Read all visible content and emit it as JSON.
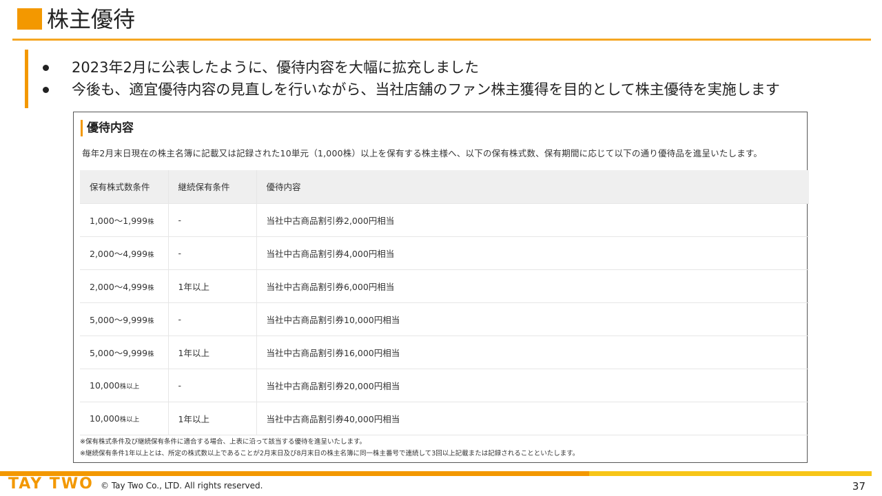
{
  "header": {
    "title": "株主優待"
  },
  "bullets": [
    "2023年2月に公表したように、優待内容を大幅に拡充しました",
    "今後も、適宜優待内容の見直しを行いながら、当社店舗のファン株主獲得を目的として株主優待を実施します"
  ],
  "panel": {
    "heading": "優待内容",
    "intro": "毎年2月末日現在の株主名簿に記載又は記録された10単元（1,000株）以上を保有する株主様へ、以下の保有株式数、保有期間に応じて以下の通り優待品を進呈いたします。",
    "columns": [
      "保有株式数条件",
      "継続保有条件",
      "優待内容"
    ],
    "rows": [
      {
        "shares": "1,000〜1,999",
        "unit": "株",
        "holding": "-",
        "benefit": "当社中古商品割引券2,000円相当"
      },
      {
        "shares": "2,000〜4,999",
        "unit": "株",
        "holding": "-",
        "benefit": "当社中古商品割引券4,000円相当"
      },
      {
        "shares": "2,000〜4,999",
        "unit": "株",
        "holding": "1年以上",
        "benefit": "当社中古商品割引券6,000円相当"
      },
      {
        "shares": "5,000〜9,999",
        "unit": "株",
        "holding": "-",
        "benefit": "当社中古商品割引券10,000円相当"
      },
      {
        "shares": "5,000〜9,999",
        "unit": "株",
        "holding": "1年以上",
        "benefit": "当社中古商品割引券16,000円相当"
      },
      {
        "shares": "10,000",
        "unit": "株以上",
        "holding": "-",
        "benefit": "当社中古商品割引券20,000円相当"
      },
      {
        "shares": "10,000",
        "unit": "株以上",
        "holding": "1年以上",
        "benefit": "当社中古商品割引券40,000円相当"
      }
    ],
    "notes": [
      "※保有株式条件及び継続保有条件に適合する場合、上表に沿って該当する優待を進呈いたします。",
      "※継続保有条件1年以上とは、所定の株式数以上であることが2月末日及び8月末日の株主名簿に同一株主番号で連続して3回以上記載または記録されることといたします。"
    ]
  },
  "footer": {
    "logo": "TAY TWO",
    "copyright": "© Tay Two Co., LTD. All rights reserved.",
    "page_number": "37"
  },
  "colors": {
    "accent": "#f39800",
    "accent_light": "#f7c518",
    "header_row": "#efefef"
  }
}
